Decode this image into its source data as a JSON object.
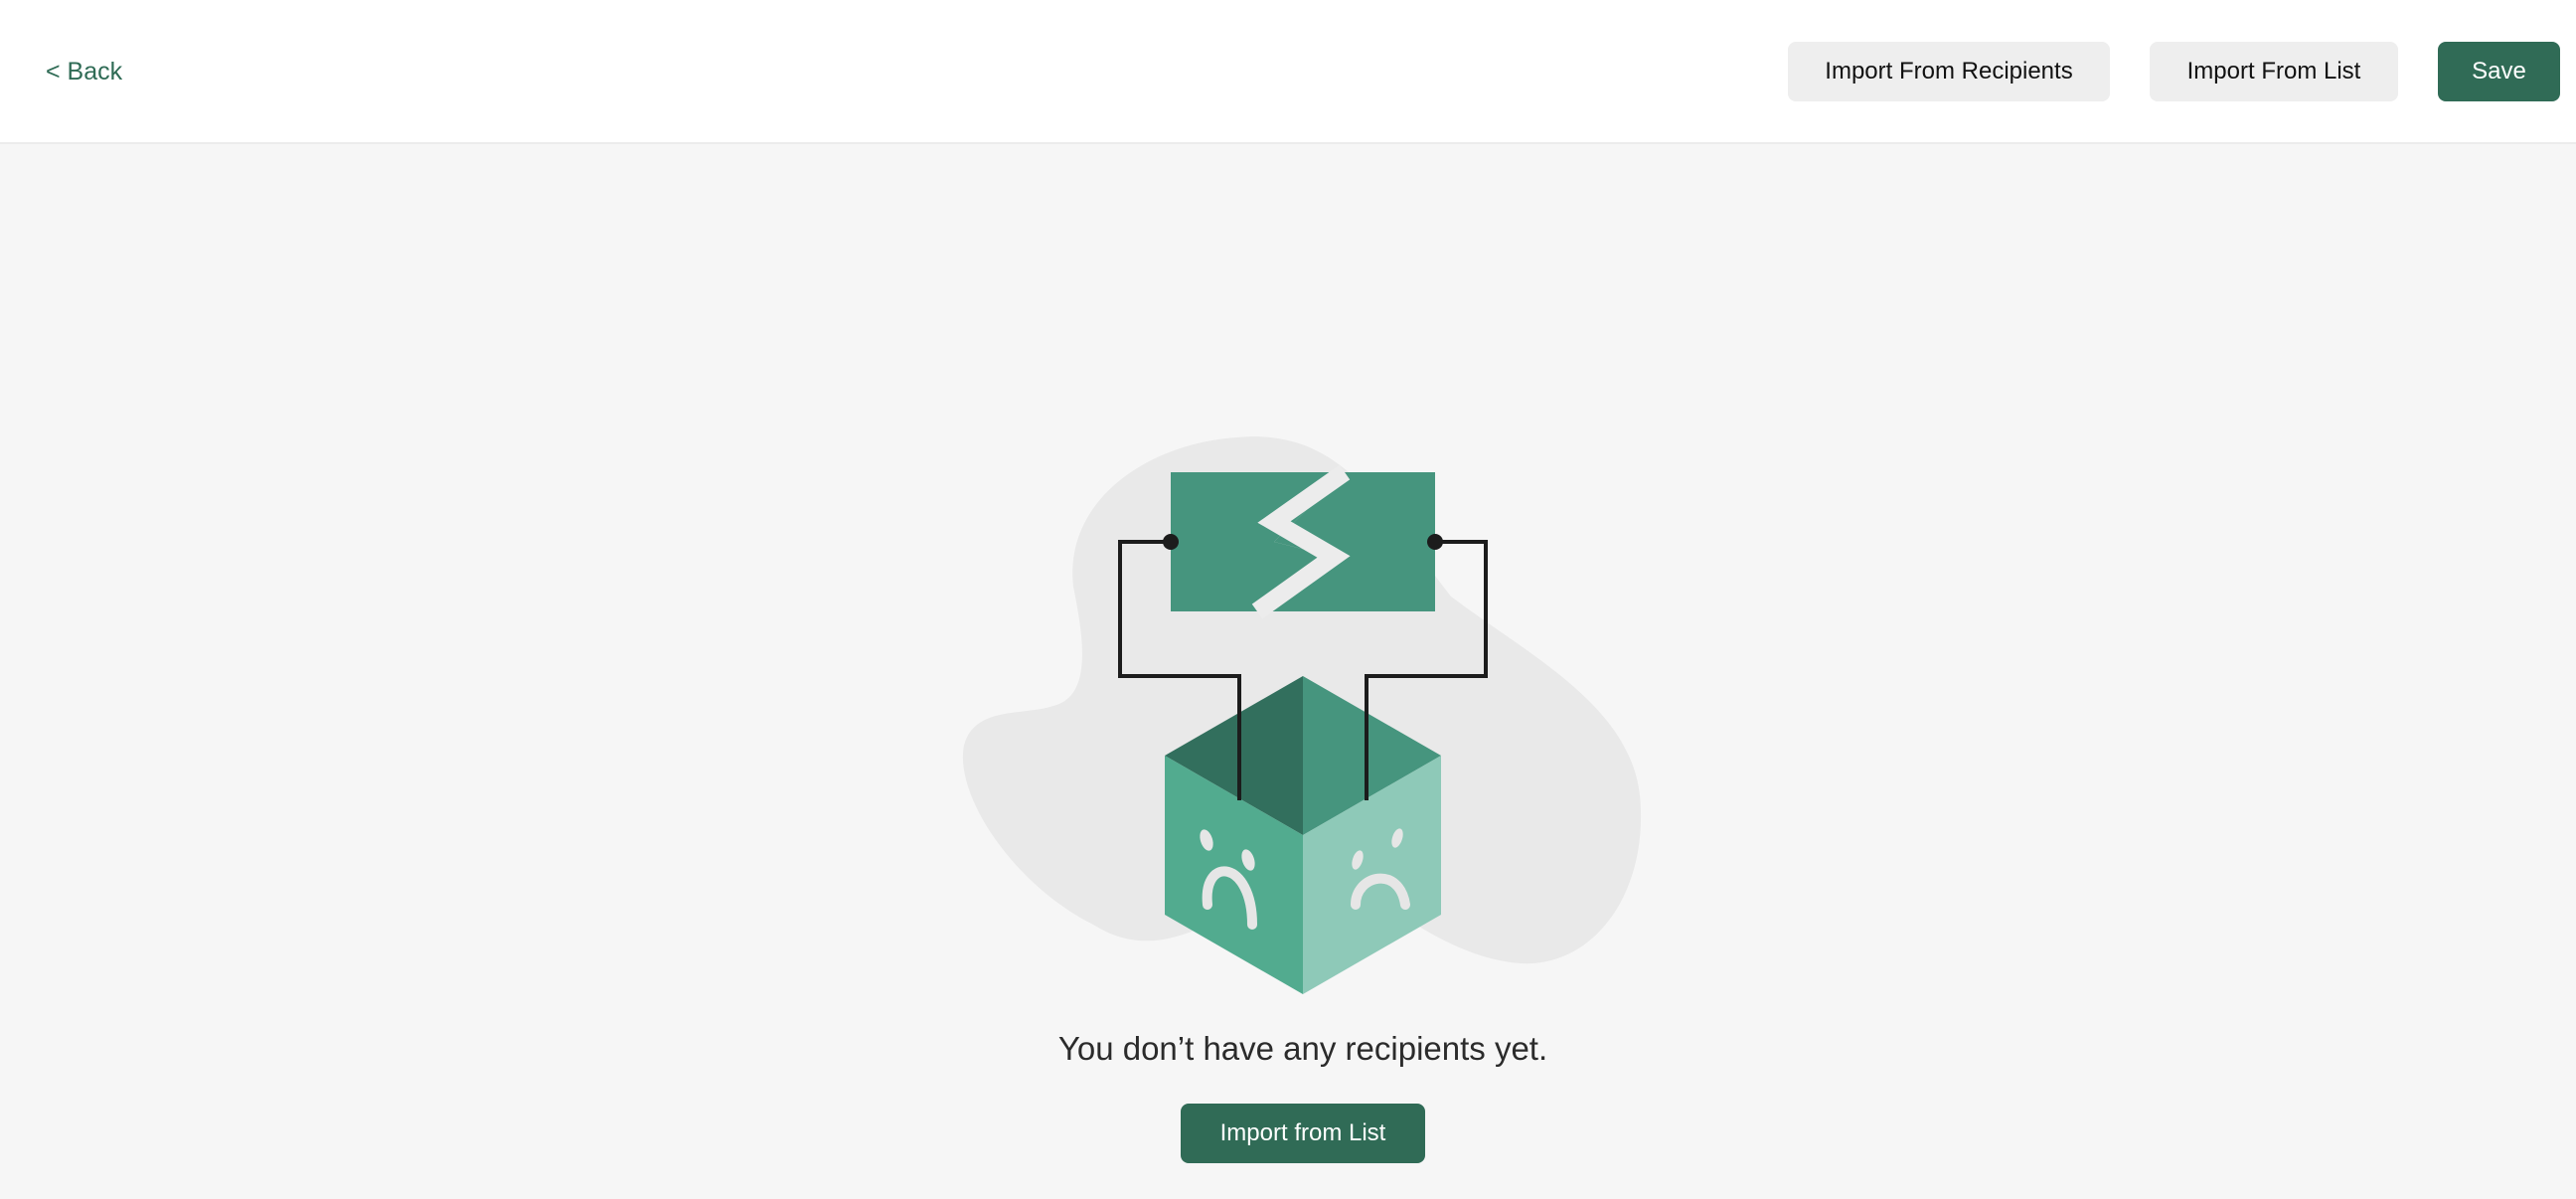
{
  "header": {
    "back_label": "< Back",
    "import_recipients_label": "Import From Recipients",
    "import_list_label": "Import From List",
    "save_label": "Save"
  },
  "empty_state": {
    "illustration_icon": "broken-connection-sad-box-illustration",
    "message": "You don’t have any recipients yet.",
    "cta_label": "Import from List"
  },
  "colors": {
    "accent": "#306b56",
    "secondary_button_bg": "#eeeeee",
    "page_bg": "#f6f6f6",
    "illustration_green": "#46957e",
    "illustration_dark_green": "#326f5d",
    "illustration_light_green": "#8ec9b8",
    "illustration_mid_green": "#52ab8f",
    "blob_gray": "#e9e9e9"
  }
}
